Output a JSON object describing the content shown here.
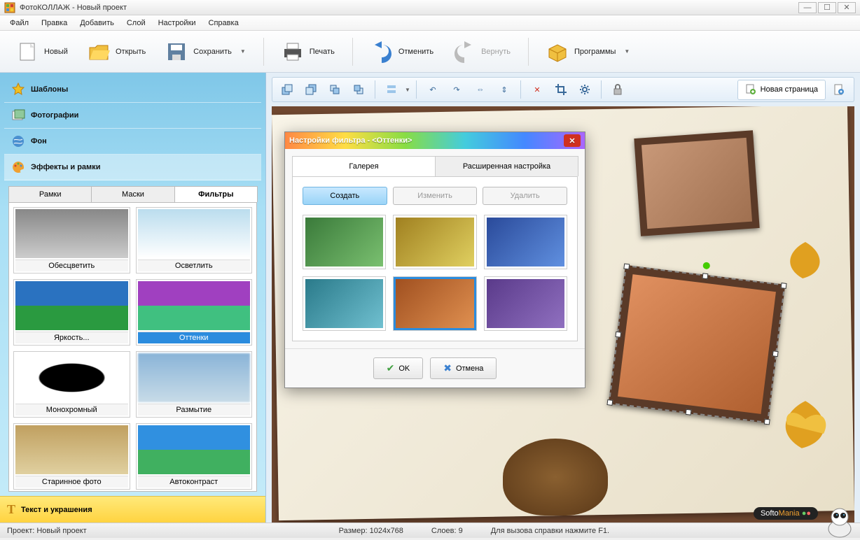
{
  "window": {
    "title": "ФотоКОЛЛАЖ - Новый проект"
  },
  "menu": {
    "file": "Файл",
    "edit": "Правка",
    "add": "Добавить",
    "layer": "Слой",
    "settings": "Настройки",
    "help": "Справка"
  },
  "toolbar": {
    "new": "Новый",
    "open": "Открыть",
    "save": "Сохранить",
    "print": "Печать",
    "undo": "Отменить",
    "redo": "Вернуть",
    "programs": "Программы",
    "newpage": "Новая страница"
  },
  "sidebar": {
    "sections": {
      "templates": "Шаблоны",
      "photos": "Фотографии",
      "background": "Фон",
      "effects": "Эффекты и рамки"
    },
    "tabs": {
      "frames": "Рамки",
      "masks": "Маски",
      "filters": "Фильтры"
    },
    "filters": [
      "Обесцветить",
      "Осветлить",
      "Яркость...",
      "Оттенки",
      "Монохромный",
      "Размытие",
      "Старинное фото",
      "Автоконтраст"
    ],
    "footer": "Текст и украшения"
  },
  "dialog": {
    "title": "Настройки фильтра - <Оттенки>",
    "tabs": {
      "gallery": "Галерея",
      "advanced": "Расширенная настройка"
    },
    "buttons": {
      "create": "Создать",
      "edit": "Изменить",
      "delete": "Удалить"
    },
    "presets_tints": [
      "green",
      "yellow",
      "blue",
      "cyan",
      "orange",
      "purple"
    ],
    "ok": "OK",
    "cancel": "Отмена"
  },
  "statusbar": {
    "project_lbl": "Проект:",
    "project": "Новый проект",
    "size_lbl": "Размер:",
    "size": "1024x768",
    "layers_lbl": "Слоев:",
    "layers": "9",
    "help": "Для вызова справки нажмите F1."
  },
  "brand": "SoftoMania"
}
